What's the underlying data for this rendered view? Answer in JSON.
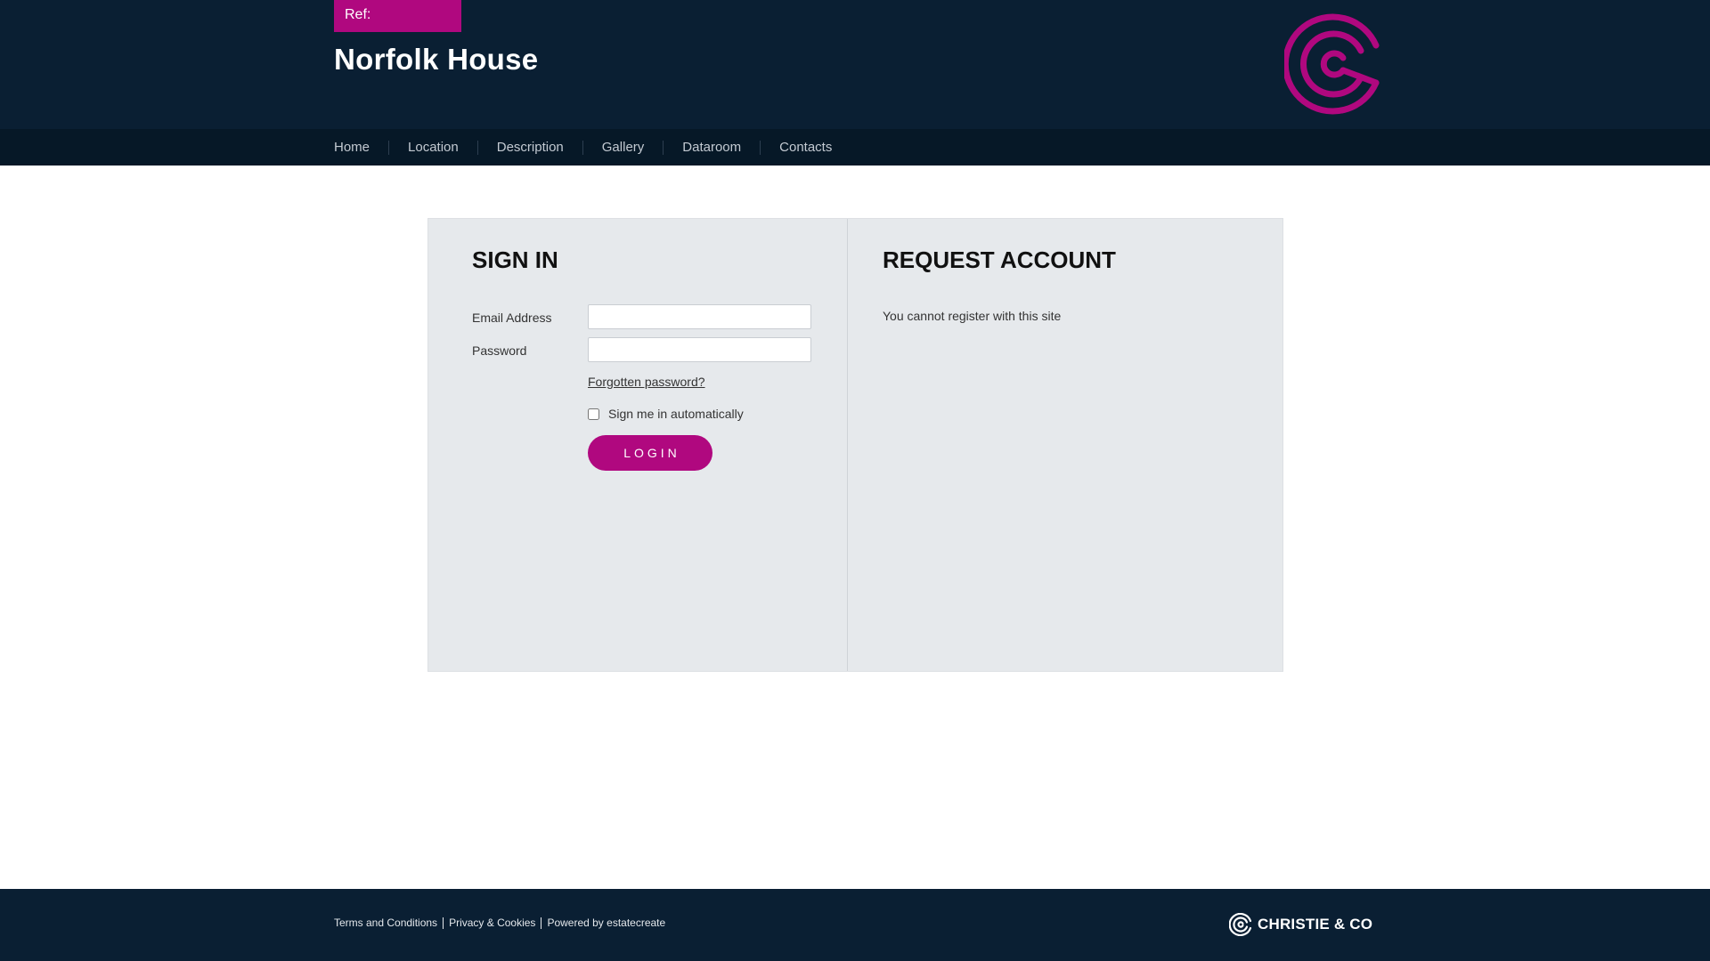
{
  "header": {
    "ref_label": "Ref:",
    "site_title": "Norfolk House",
    "logo_icon": "christie-c-logo-icon",
    "accent_color": "#b0087f",
    "background_color": "#0a1f33"
  },
  "nav": {
    "items": [
      {
        "label": "Home"
      },
      {
        "label": "Location"
      },
      {
        "label": "Description"
      },
      {
        "label": "Gallery"
      },
      {
        "label": "Dataroom"
      },
      {
        "label": "Contacts"
      }
    ]
  },
  "signin": {
    "title": "SIGN IN",
    "email_label": "Email Address",
    "email_value": "",
    "password_label": "Password",
    "password_value": "",
    "forgot_link": "Forgotten password?",
    "remember_label": "Sign me in automatically",
    "remember_checked": false,
    "login_button": "LOGIN"
  },
  "request": {
    "title": "REQUEST ACCOUNT",
    "message": "You cannot register with this site"
  },
  "footer": {
    "links": [
      {
        "label": "Terms and Conditions"
      },
      {
        "label": "Privacy & Cookies"
      },
      {
        "label": "Powered by estatecreate"
      }
    ],
    "brand": "CHRISTIE & CO"
  }
}
